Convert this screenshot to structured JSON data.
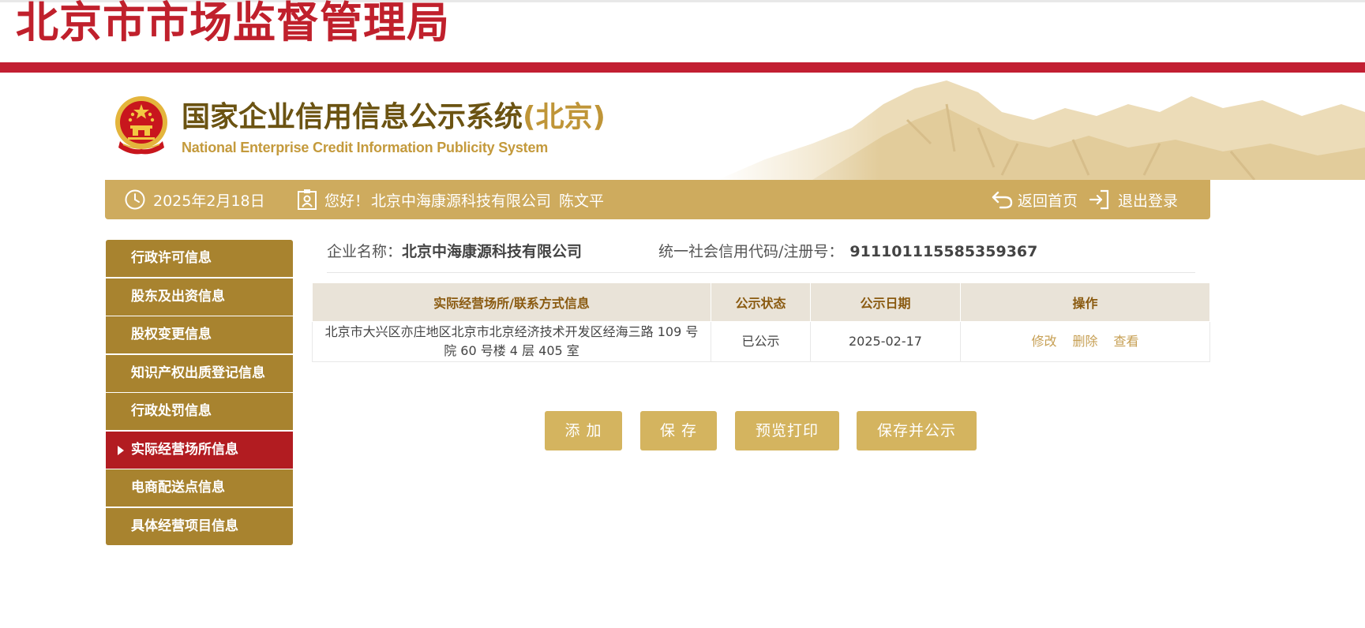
{
  "header": {
    "bureau_title": "北京市市场监督管理局",
    "system_title": "国家企业信用信息公示系统",
    "system_region": "(北京)",
    "system_subtitle_en": "National Enterprise Credit Information Publicity System"
  },
  "infobar": {
    "date": "2025年2月18日",
    "greeting": "您好！",
    "company": "北京中海康源科技有限公司",
    "user": "陈文平",
    "home_label": "返回首页",
    "logout_label": "退出登录"
  },
  "sidebar": {
    "items": [
      {
        "label": "行政许可信息",
        "active": false
      },
      {
        "label": "股东及出资信息",
        "active": false
      },
      {
        "label": "股权变更信息",
        "active": false
      },
      {
        "label": "知识产权出质登记信息",
        "active": false
      },
      {
        "label": "行政处罚信息",
        "active": false
      },
      {
        "label": "实际经营场所信息",
        "active": true
      },
      {
        "label": "电商配送点信息",
        "active": false
      },
      {
        "label": "具体经营项目信息",
        "active": false
      }
    ]
  },
  "enterprise": {
    "name_label": "企业名称：",
    "name_value": "北京中海康源科技有限公司",
    "code_label": "统一社会信用代码/注册号：",
    "code_value": "911101115585359367"
  },
  "table": {
    "headers": [
      "实际经营场所/联系方式信息",
      "公示状态",
      "公示日期",
      "操作"
    ],
    "rows": [
      {
        "address": "北京市大兴区亦庄地区北京市北京经济技术开发区经海三路 109 号院 60 号楼 4 层 405 室",
        "status": "已公示",
        "date": "2025-02-17",
        "ops": [
          "修改",
          "删除",
          "查看"
        ]
      }
    ]
  },
  "buttons": {
    "add": "添 加",
    "save": "保 存",
    "preview_print": "预览打印",
    "save_publish": "保存并公示"
  },
  "colors": {
    "brand_red": "#c21f32",
    "gold_bar": "#ceab5e",
    "sidebar_gold": "#a8832f",
    "sidebar_active": "#b21c21",
    "button_gold": "#d4b45f"
  }
}
